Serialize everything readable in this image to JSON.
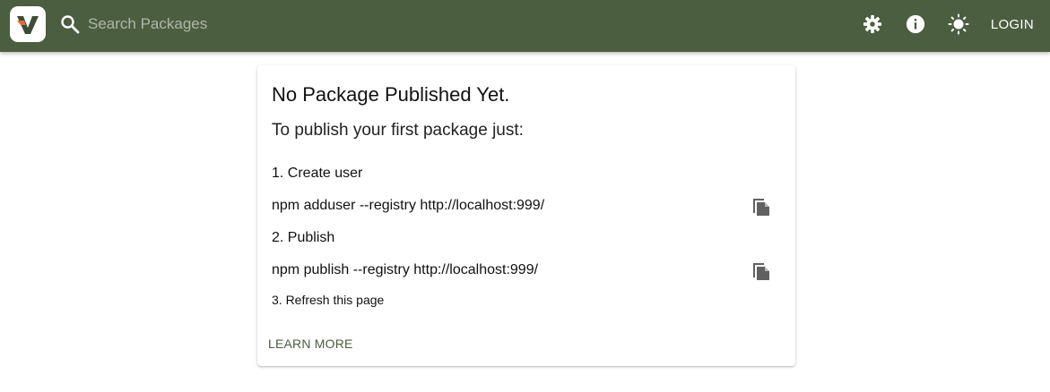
{
  "header": {
    "search_placeholder": "Search Packages",
    "login_label": "LOGIN",
    "icons": [
      "logo-icon",
      "search-icon",
      "gear-icon",
      "info-icon",
      "sun-icon"
    ]
  },
  "colors": {
    "header_bg": "#4b5e40",
    "accent": "#4b5e40",
    "logo_dark": "#3f4d37",
    "logo_orange": "#e46a32"
  },
  "card": {
    "title": "No Package Published Yet.",
    "subtitle": "To publish your first package just:",
    "step1_label": "1. Create user",
    "step1_command": "npm adduser --registry http://localhost:999/",
    "step2_label": "2. Publish",
    "step2_command": "npm publish --registry http://localhost:999/",
    "step3_label": "3. Refresh this page",
    "learn_more": "LEARN MORE"
  }
}
